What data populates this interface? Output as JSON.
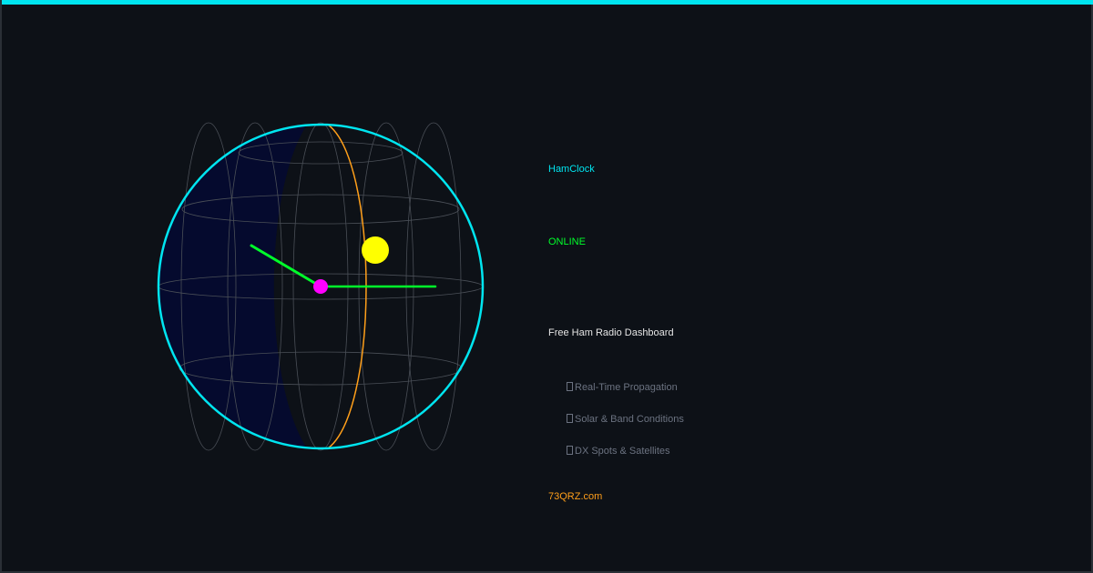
{
  "app": {
    "title": "HamClock",
    "status": "ONLINE",
    "tagline": "Free Ham Radio Dashboard",
    "features": [
      "Real-Time Propagation",
      "Solar & Band Conditions",
      "DX Spots & Satellites"
    ],
    "site": "73QRZ.com"
  },
  "colors": {
    "background": "#0d1117",
    "accent": "#00e5f0",
    "status": "#00ff2a",
    "site": "#ff9f1a",
    "globe_outline": "#00e5f0",
    "night_side": "#050a2e",
    "terminator": "#ff9f1a",
    "sun": "#ffff00",
    "station": "#ff00ff",
    "clock_hands": "#00ff2a",
    "grid": "#4a4f57"
  },
  "icons": {
    "bullet": "feature-bullet-icon",
    "sun": "sun-icon",
    "station": "station-marker-icon"
  }
}
